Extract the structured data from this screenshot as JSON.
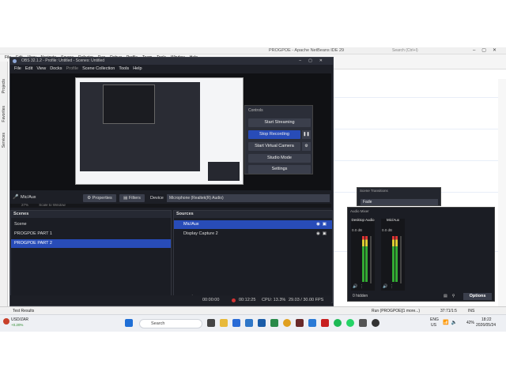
{
  "netbeans": {
    "title": "PROGPOE - Apache NetBeans IDE 29",
    "search_placeholder": "Search (Ctrl+I)",
    "menu": [
      "File",
      "Edit",
      "View",
      "Navigate",
      "Source",
      "Refactor",
      "Run",
      "Debug",
      "Profile",
      "Team",
      "Tools",
      "Window",
      "Help"
    ],
    "side_tabs": [
      "Projects",
      "Favorites",
      "Services"
    ],
    "bottom_left": "Test Results",
    "bottom_right": [
      "Run (PROGPOE)",
      "(1 more...)",
      "37:71/1:5",
      "INS"
    ]
  },
  "obs": {
    "title": "OBS 32.1.2 - Profile: Untitled - Scenes: Untitled",
    "menu": [
      "File",
      "Edit",
      "View",
      "Docks",
      "Profile",
      "Scene Collection",
      "Tools",
      "Help"
    ],
    "preview_zoom": "27%",
    "preview_mode": "Scale to Window",
    "controls": {
      "header": "Controls",
      "start_streaming": "Start Streaming",
      "stop_recording": "Stop Recording",
      "start_virtual_camera": "Start Virtual Camera",
      "studio_mode": "Studio Mode",
      "settings": "Settings"
    },
    "propbar": {
      "source": "Mic/Aux",
      "properties": "Properties",
      "filters": "Filters",
      "device_label": "Device",
      "device_value": "Microphone (Realtek(R) Audio)"
    },
    "scenes": {
      "header": "Scenes",
      "items": [
        "Scene",
        "PROGPOE PART 1",
        "PROGPOE PART 2"
      ],
      "selected": 2
    },
    "sources": {
      "header": "Sources",
      "items": [
        "Mic/Aux",
        "Display Capture 2"
      ]
    },
    "status": {
      "stream_time": "00:00:00",
      "rec_time": "00:12:25",
      "cpu": "CPU: 13.3%",
      "fps": "29.03 / 30.00 FPS"
    },
    "transitions": {
      "header": "Scene Transitions",
      "value": "Fade"
    },
    "mixer": {
      "header": "Audio Mixer",
      "channels": [
        {
          "name": "Desktop Audio",
          "level": "0.0 dB"
        },
        {
          "name": "Mic/Aux",
          "level": "0.0 dB"
        }
      ],
      "hidden": "0 hidden",
      "options": "Options"
    }
  },
  "taskbar": {
    "weather_pair": "USD/ZAR",
    "weather_change": "+0.20%",
    "search": "Search",
    "lang": "ENG",
    "region": "US",
    "battery": "42%",
    "time": "18:22",
    "date": "2026/05/24"
  },
  "colors": {
    "obs_bg": "#1d1f26",
    "accent": "#284cb8",
    "record": "#d33333"
  }
}
